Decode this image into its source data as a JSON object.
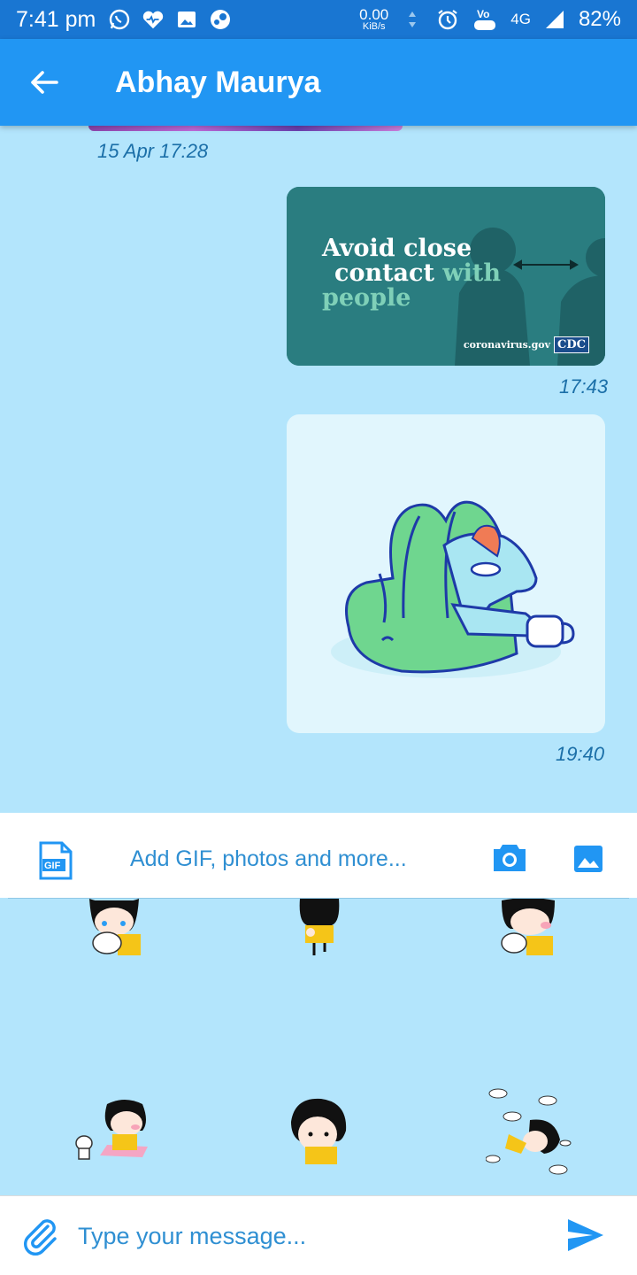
{
  "status_bar": {
    "time": "7:41 pm",
    "net_speed_value": "0.00",
    "net_speed_unit": "KiB/s",
    "lte_badge": "LTE",
    "network": "4G",
    "battery": "82%",
    "icons": [
      "whatsapp-icon",
      "heart-icon",
      "gallery-icon",
      "steam-icon",
      "alarm-icon",
      "volte-icon",
      "signal-icon"
    ]
  },
  "app_bar": {
    "title": "Abhay Maurya"
  },
  "chat": {
    "messages": [
      {
        "type": "image",
        "timestamp": "15 Apr 17:28"
      },
      {
        "type": "image",
        "timestamp": "17:43",
        "card": {
          "line1": "Avoid close",
          "line2a": "contact ",
          "line2b": "with",
          "line3": "people",
          "source": "coronavirus.gov",
          "logo": "CDC"
        }
      },
      {
        "type": "sticker",
        "timestamp": "19:40"
      }
    ]
  },
  "media_bar": {
    "label": "Add GIF, photos and more...",
    "gif_label": "GIF"
  },
  "composer": {
    "placeholder": "Type your message..."
  },
  "colors": {
    "status_bar": "#1976d2",
    "app_bar": "#2196f3",
    "chat_bg": "#b3e5fc",
    "accent": "#2196f3"
  }
}
